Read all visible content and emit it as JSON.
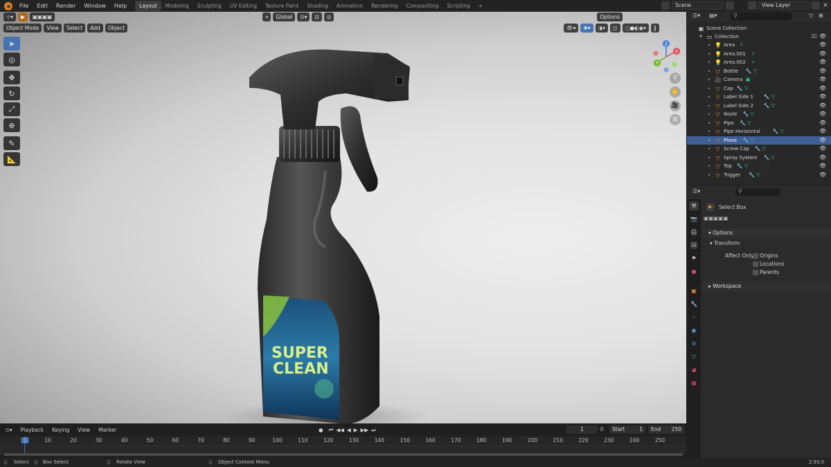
{
  "topbar": {
    "menus": [
      "File",
      "Edit",
      "Render",
      "Window",
      "Help"
    ],
    "workspaces": [
      "Layout",
      "Modeling",
      "Sculpting",
      "UV Editing",
      "Texture Paint",
      "Shading",
      "Animation",
      "Rendering",
      "Compositing",
      "Scripting"
    ],
    "active_workspace": "Layout",
    "add_workspace": "+",
    "scene": "Scene",
    "view_layer": "View Layer"
  },
  "viewport": {
    "orientation": "Global",
    "options_label": "Options",
    "mode": "Object Mode",
    "menus": [
      "View",
      "Select",
      "Add",
      "Object"
    ]
  },
  "gizmo": {
    "x": "X",
    "y": "Y",
    "z": "Z"
  },
  "product": {
    "brand_line1": "SUPER",
    "brand_line2": "CLEAN"
  },
  "outliner": {
    "root": "Scene Collection",
    "collection": "Collection",
    "items": [
      {
        "name": "Area",
        "type": "light",
        "selected": false
      },
      {
        "name": "Area.001",
        "type": "light",
        "selected": false
      },
      {
        "name": "Area.002",
        "type": "light",
        "selected": false
      },
      {
        "name": "Bottle",
        "type": "mesh",
        "selected": false
      },
      {
        "name": "Camera",
        "type": "camera",
        "selected": false
      },
      {
        "name": "Cap",
        "type": "mesh",
        "selected": false
      },
      {
        "name": "Label Side 1",
        "type": "mesh",
        "selected": false
      },
      {
        "name": "Label Side 2",
        "type": "mesh",
        "selected": false
      },
      {
        "name": "Nozle",
        "type": "mesh",
        "selected": false
      },
      {
        "name": "Pipe",
        "type": "mesh",
        "selected": false
      },
      {
        "name": "Pipe Horizontal",
        "type": "mesh",
        "selected": false
      },
      {
        "name": "Plane",
        "type": "mesh",
        "selected": true
      },
      {
        "name": "Screw Cap",
        "type": "mesh",
        "selected": false
      },
      {
        "name": "Spray System",
        "type": "mesh",
        "selected": false
      },
      {
        "name": "Top",
        "type": "mesh",
        "selected": false
      },
      {
        "name": "Trigger",
        "type": "mesh",
        "selected": false
      }
    ]
  },
  "properties": {
    "tool_name": "Select Box",
    "options_panel": "Options",
    "transform_subpanel": "Transform",
    "affect_only": "Affect Only",
    "checkboxes": [
      "Origins",
      "Locations",
      "Parents"
    ],
    "workspace_panel": "Workspace"
  },
  "timeline": {
    "menus": [
      "Playback",
      "Keying",
      "View",
      "Marker"
    ],
    "current_frame": "1",
    "start_label": "Start",
    "start": "1",
    "end_label": "End",
    "end": "250",
    "ticks": [
      "1",
      "10",
      "20",
      "30",
      "40",
      "50",
      "60",
      "70",
      "80",
      "90",
      "100",
      "110",
      "120",
      "130",
      "140",
      "150",
      "160",
      "170",
      "180",
      "190",
      "200",
      "210",
      "220",
      "230",
      "240",
      "250"
    ],
    "transport": [
      "⏮",
      "◀◀",
      "◀",
      "▶",
      "▶▶",
      "⏭"
    ]
  },
  "statusbar": {
    "select": "Select",
    "box_select": "Box Select",
    "rotate_view": "Rotate View",
    "context_menu": "Object Context Menu",
    "version": "2.93.0"
  },
  "colors": {
    "accent": "#4772b3",
    "selection": "#3f5f96",
    "header_bg": "#232323",
    "panel_bg": "#2b2b2b",
    "mesh_icon": "#e28b2c",
    "light_icon": "#e28b2c",
    "camera_icon": "#e28b2c"
  }
}
